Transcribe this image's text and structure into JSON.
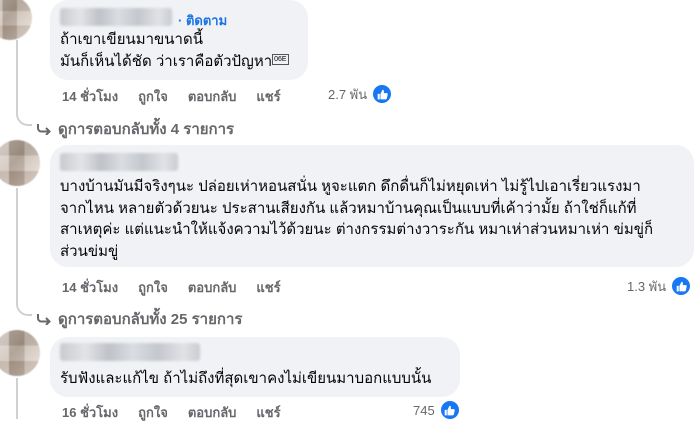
{
  "comments": [
    {
      "follow_label": "· ติดตาม",
      "lines": [
        "ถ้าเขาเขียนมาขนาดนี้",
        "มันก็เห็นได้ชัด ว่าเราคือตัวปัญหา"
      ],
      "emoji_code": "06E",
      "time": "14 ชั่วโมง",
      "like_label": "ถูกใจ",
      "reply_label": "ตอบกลับ",
      "share_label": "แชร์",
      "reaction_count": "2.7 พัน",
      "replies_label": "ดูการตอบกลับทั้ง 4 รายการ"
    },
    {
      "lines": [
        "บางบ้านมันมีจริงๆนะ ปล่อยเห่าหอนสนั่น หูจะแตก ดึกดื่นก็ไม่หยุดเห่า ไม่รู้ไปเอาเรี่ยวแรงมา",
        "จากไหน หลายตัวด้วยนะ ประสานเสียงกัน แล้วหมาบ้านคุณเป็นแบบที่เค้าว่ามั้ย ถ้าใช่ก็แก้ที่",
        "สาเหตุค่ะ แต่แนะนำให้แจ้งความไว้ด้วยนะ ต่างกรรมต่างวาระกัน หมาเห่าส่วนหมาเห่า ข่มขู่ก็",
        "ส่วนข่มขู่"
      ],
      "time": "14 ชั่วโมง",
      "like_label": "ถูกใจ",
      "reply_label": "ตอบกลับ",
      "share_label": "แชร์",
      "reaction_count": "1.3 พัน",
      "replies_label": "ดูการตอบกลับทั้ง 25 รายการ"
    },
    {
      "lines": [
        "รับฟังและแก้ไข ถ้าไม่ถึงที่สุดเขาคงไม่เขียนมาบอกแบบนั้น"
      ],
      "time": "16 ชั่วโมง",
      "like_label": "ถูกใจ",
      "reply_label": "ตอบกลับ",
      "share_label": "แชร์",
      "reaction_count": "745"
    }
  ],
  "colors": {
    "bubble": "#f0f2f5",
    "text": "#050505",
    "meta": "#65676b",
    "link": "#1b74e4",
    "like": "#1877f2"
  },
  "icons": {
    "like": "thumbs-up-icon",
    "reply": "reply-arrow-icon"
  }
}
